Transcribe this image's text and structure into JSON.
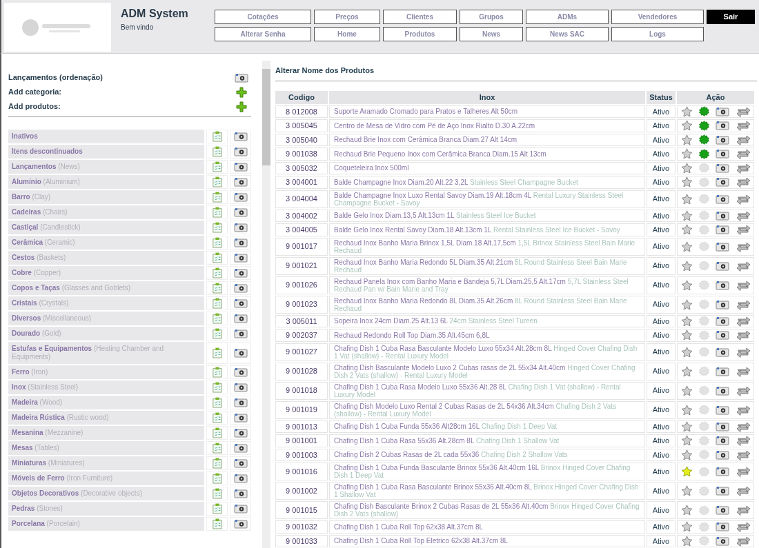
{
  "header": {
    "title": "ADM System",
    "subtitle": "Bem vindo"
  },
  "nav": [
    [
      {
        "label": "Cotações"
      },
      {
        "label": "Preços"
      },
      {
        "label": "Clientes"
      },
      {
        "label": "Grupos"
      },
      {
        "label": "ADMs"
      },
      {
        "label": "Vendedores"
      }
    ],
    [
      {
        "label": "Alterar Senha"
      },
      {
        "label": "Home"
      },
      {
        "label": "Produtos"
      },
      {
        "label": "News"
      },
      {
        "label": "News SAC"
      },
      {
        "label": "Logs"
      }
    ]
  ],
  "logout": "Sair",
  "sidebar": {
    "actions": [
      {
        "label": "Lançamentos (ordenação)",
        "kind": "camera"
      },
      {
        "label": "Add categoria:",
        "kind": "plus"
      },
      {
        "label": "Add produtos:",
        "kind": "plus"
      }
    ],
    "categories": [
      {
        "name": "Inativos"
      },
      {
        "name": "Itens descontinuados"
      },
      {
        "name": "Lançamentos",
        "english": "(News)"
      },
      {
        "name": "Alumínio",
        "english": "(Aluminium)"
      },
      {
        "name": "Barro",
        "english": "(Clay)"
      },
      {
        "name": "Cadeiras",
        "english": "(Chairs)"
      },
      {
        "name": "Castiçal",
        "english": "(Candlestick)"
      },
      {
        "name": "Cerâmica",
        "english": "(Ceramic)"
      },
      {
        "name": "Cestos",
        "english": "(Baskets)"
      },
      {
        "name": "Cobre",
        "english": "(Copper)"
      },
      {
        "name": "Copos e Taças",
        "english": "(Glasses and Goblets)"
      },
      {
        "name": "Cristais",
        "english": "(Crystals)"
      },
      {
        "name": "Diversos",
        "english": "(Miscellaneous)"
      },
      {
        "name": "Dourado",
        "english": "(Gold)"
      },
      {
        "name": "Estufas e Equipamentos",
        "english": "(Heating Chamber and Equipments)"
      },
      {
        "name": "Ferro",
        "english": "(Iron)"
      },
      {
        "name": "Inox",
        "english": "(Stainless Steel)"
      },
      {
        "name": "Madeira",
        "english": "(Wood)"
      },
      {
        "name": "Madeira Rústica",
        "english": "(Rustic wood)"
      },
      {
        "name": "Mesanina",
        "english": "(Mezzanine)"
      },
      {
        "name": "Mesas",
        "english": "(Tables)"
      },
      {
        "name": "Miniaturas",
        "english": "(Miniatures)"
      },
      {
        "name": "Móveis de Ferro",
        "english": "(Iron Furniture)"
      },
      {
        "name": "Objetos Decorativos",
        "english": "(Decorative objects)"
      },
      {
        "name": "Pedras",
        "english": "(Stones)"
      },
      {
        "name": "Porcelana",
        "english": "(Porcelain)"
      }
    ]
  },
  "main": {
    "title": "Alterar Nome dos Produtos",
    "columns": [
      "Codigo",
      "Inox",
      "Status",
      "Ação"
    ],
    "products": [
      {
        "code": "8 012008",
        "name": "Suporte Aramado Cromado para Pratos e Talheres Alt 50cm",
        "status": "Ativo",
        "featured": false,
        "new": true
      },
      {
        "code": "3 005045",
        "name": "Centro de Mesa de Vidro com Pé de Aço Inox Rialto D.30 A.22cm",
        "status": "Ativo",
        "featured": false,
        "new": true
      },
      {
        "code": "3 005040",
        "name": "Rechaud Brie Inox com Cerâmica Branca Diam.27 Alt 14cm",
        "status": "Ativo",
        "featured": false,
        "new": true
      },
      {
        "code": "9 001038",
        "name": "Rechaud Brie Pequeno Inox com Cerâmica Branca Diam.15 Alt 13cm",
        "status": "Ativo",
        "featured": false,
        "new": true
      },
      {
        "code": "3 005032",
        "name": "Coqueteleira Inox 500ml",
        "status": "Ativo",
        "featured": false,
        "new": false
      },
      {
        "code": "3 004001",
        "name": "Balde Champagne Inox Diam.20 Alt.22 3,2L",
        "english": "Stainless Steel Champagne Bucket",
        "status": "Ativo",
        "featured": false,
        "new": false
      },
      {
        "code": "3 004004",
        "name": "Balde Champagne Inox Luxo Rental Savoy Diam.19 Alt.18cm 4L",
        "english": "Rental Luxury Stainless Steel Champagne Bucket - Savoy",
        "status": "Ativo",
        "featured": false,
        "new": false
      },
      {
        "code": "3 004002",
        "name": "Balde Gelo Inox Diam.13,5 Alt.13cm 1L",
        "english": "Stainless Steel Ice Bucket",
        "status": "Ativo",
        "featured": false,
        "new": false
      },
      {
        "code": "3 004005",
        "name": "Balde Gelo Inox Rental Savoy Diam.18 Alt.13cm 1L",
        "english": "Rental Stainless Steel Ice Bucket - Savoy",
        "status": "Ativo",
        "featured": false,
        "new": false
      },
      {
        "code": "9 001017",
        "name": "Rechaud Inox Banho Maria Brinox 1,5L Diam.18 Alt.17,5cm",
        "english": "1,5L Brinox Stainless Steel Bain Marie Rechaud",
        "status": "Ativo",
        "featured": false,
        "new": false
      },
      {
        "code": "9 001021",
        "name": "Rechaud Inox Banho Maria Redondo 5L Diam.35 Alt.21cm",
        "english": "5L Round Stainless Steel Bain Marie Rechaud",
        "status": "Ativo",
        "featured": false,
        "new": false
      },
      {
        "code": "9 001026",
        "name": "Rechaud Panela Inox com Banho Maria e Bandeja 5,7L Diam.25,5 Alt.17cm",
        "english": "5,7L Stainless Steel Rechaud Pan w/ Bain Marie and Tray",
        "status": "Ativo",
        "featured": false,
        "new": false
      },
      {
        "code": "9 001023",
        "name": "Rechaud Inox Banho Maria Redondo 8L Diam.35 Alt.26cm",
        "english": "8L Round Stainless Steel Bain Marie Rechaud",
        "status": "Ativo",
        "featured": false,
        "new": false
      },
      {
        "code": "3 005011",
        "name": "Sopeira Inox 24cm Diam.25 Alt.13 6L",
        "english": "24cm Stainless Steel Tureen",
        "status": "Ativo",
        "featured": false,
        "new": false
      },
      {
        "code": "9 002037",
        "name": "Rechaud Redondo Roll Top Diam.35 Alt.45cm 6,8L",
        "status": "Ativo",
        "featured": false,
        "new": false
      },
      {
        "code": "9 001027",
        "name": "Chafing Dish 1 Cuba Rasa Basculante Modelo Luxo 55x34 Alt.28cm 8L",
        "english": "Hinged Cover Chafing Dish 1 Vat (shallow) - Rental Luxury Model",
        "status": "Ativo",
        "featured": false,
        "new": false
      },
      {
        "code": "9 001028",
        "name": "Chafing Dish Basculante Modelo Luxo 2 Cubas rasas de 2L 55x34 Alt.40cm",
        "english": "Hinged Cover Chafing Dish 2 Vats (shallow) - Rental Luxury Model",
        "status": "Ativo",
        "featured": false,
        "new": false
      },
      {
        "code": "9 001018",
        "name": "Chafing Dish 1 Cuba Rasa Modelo Luxo 55x36 Alt.28 8L",
        "english": "Chafing Dish 1 Vat (shallow) - Rental Luxury Model",
        "status": "Ativo",
        "featured": false,
        "new": false
      },
      {
        "code": "9 001019",
        "name": "Chafing Dish Modelo Luxo Rental 2 Cubas Rasas de 2L 54x36 Alt.34cm",
        "english": "Chafing Dish 2 Vats (shallow) - Rental Luxury Model",
        "status": "Ativo",
        "featured": false,
        "new": false
      },
      {
        "code": "9 001013",
        "name": "Chafing Dish 1 Cuba Funda 55x36 Alt28cm 16L",
        "english": "Chafing Dish 1 Deep Vat",
        "status": "Ativo",
        "featured": false,
        "new": false
      },
      {
        "code": "9 001001",
        "name": "Chafing Dish 1 Cuba Rasa 55x36 Alt.28cm 8L",
        "english": "Chafing Dish 1 Shallow Vat",
        "status": "Ativo",
        "featured": false,
        "new": false
      },
      {
        "code": "9 001003",
        "name": "Chafing Dish 2 Cubas Rasas de 2L cada 55x36",
        "english": "Chafing Dish 2 Shallow Vats",
        "status": "Ativo",
        "featured": false,
        "new": false
      },
      {
        "code": "9 001016",
        "name": "Chafing Dish 1 Cuba Funda Basculante Brinox 55x36 Alt.40cm 16L",
        "english": "Brinox Hinged Cover Chafing Dish 1 Deep Vat",
        "status": "Ativo",
        "featured": true,
        "new": false
      },
      {
        "code": "9 001002",
        "name": "Chafing Dish 1 Cuba Rasa Basculante Brinox 55x36 Alt.40cm 8L",
        "english": "Brinox Hinged Cover Chafing Dish 1 Shallow Vat",
        "status": "Ativo",
        "featured": false,
        "new": false
      },
      {
        "code": "9 001015",
        "name": "Chafing Dish Basculante Brinox 2 Cubas Rasas de 2L 55x36 Alt.40cm",
        "english": "Brinox Hinged Cover Chafing Dish 2 Vats (shallow)",
        "status": "Ativo",
        "featured": false,
        "new": false
      },
      {
        "code": "9 001032",
        "name": "Chafing Dish 1 Cuba Roll Top 62x38 Alt.37cm 8L",
        "status": "Ativo",
        "featured": false,
        "new": false
      },
      {
        "code": "9 001033",
        "name": "Chafing Dish 1 Cuba Roll Top Eletrico 62x38 Alt.37cm 8L",
        "status": "Ativo",
        "featured": false,
        "new": false
      }
    ]
  }
}
